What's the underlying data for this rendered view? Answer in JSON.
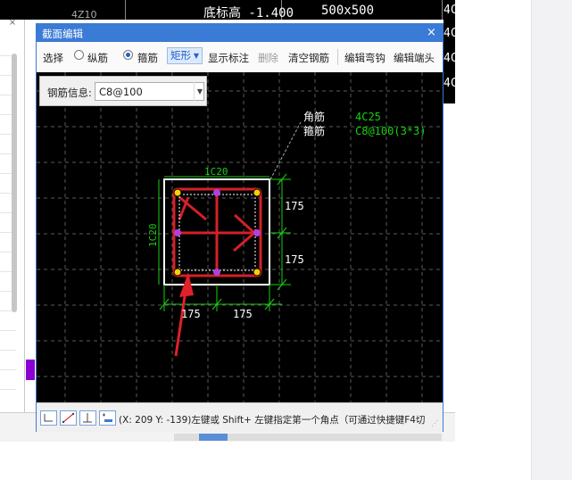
{
  "background": {
    "elevation_label": "底标高 -1.400",
    "size_label": "500x500",
    "code_label": "4Z10",
    "right_labels": [
      "4C",
      "4C",
      "4C",
      "4C"
    ]
  },
  "dialog": {
    "title": "截面编辑",
    "close_icon": "×"
  },
  "toolbar": {
    "select": "选择",
    "longitudinal": "纵筋",
    "stirrup": "箍筋",
    "shape": "矩形",
    "show_dims": "显示标注",
    "delete": "删除",
    "clear": "清空钢筋",
    "edit_bend": "编辑弯钩",
    "edit_end": "编辑端头",
    "selected_mode": "stirrup"
  },
  "rebar_info": {
    "label": "钢筋信息:",
    "value": "C8@100"
  },
  "drawing": {
    "corner_label": "角筋",
    "corner_value": "4C25",
    "stirrup_label": "箍筋",
    "stirrup_value": "C8@100(3*3)",
    "top_label": "1C20",
    "left_label": "1C20",
    "dim_right_top": "175",
    "dim_right_bottom": "175",
    "dim_bottom_left": "175",
    "dim_bottom_right": "175"
  },
  "statusbar": {
    "text": "(X: 209 Y: -139)左键或 Shift+ 左键指定第一个角点（可通过快捷键F4切"
  },
  "colors": {
    "accent": "#3a7bd5",
    "rebar_red": "#e0202a",
    "dim_green": "#18d010",
    "purple": "#8a00d4"
  }
}
